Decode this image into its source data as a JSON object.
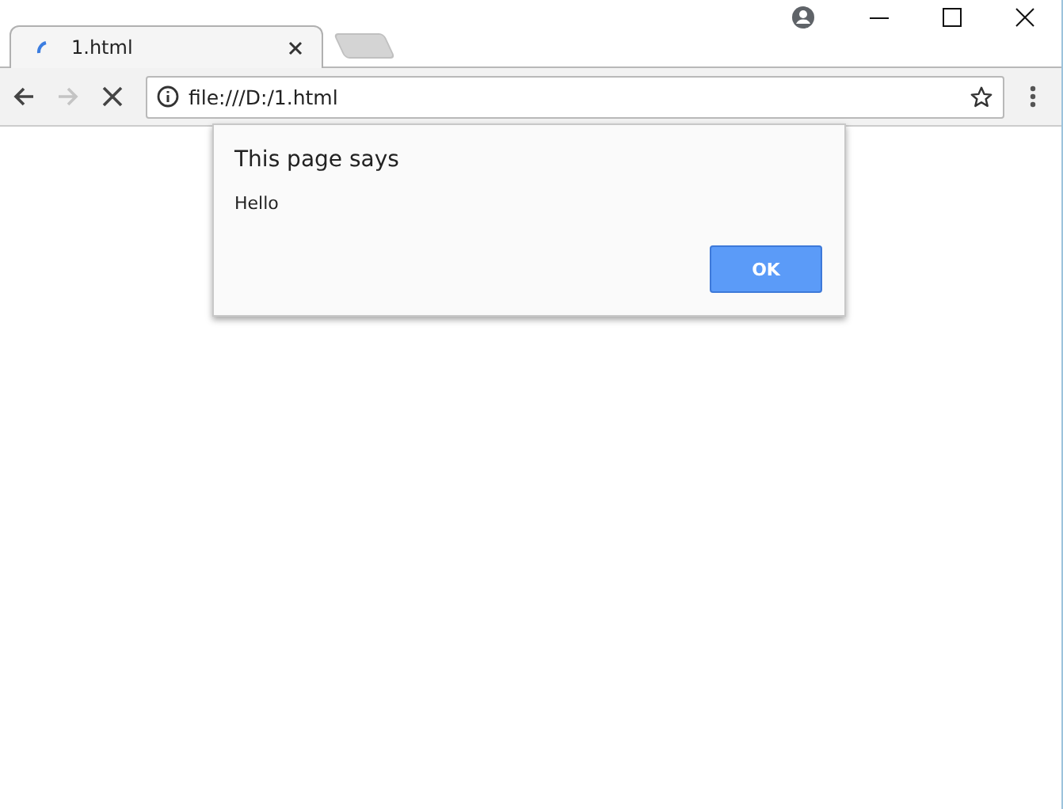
{
  "tabs": [
    {
      "title": "1.html",
      "loading": true,
      "selected": true
    }
  ],
  "toolbar": {
    "nav": [
      {
        "kind": "back",
        "disabled": false
      },
      {
        "kind": "forward",
        "disabled": true
      },
      {
        "kind": "stop",
        "disabled": false
      }
    ],
    "address": {
      "url": "file:///D:/1.html"
    }
  },
  "dialog": {
    "title": "This page says",
    "message": "Hello",
    "buttons": [
      {
        "label": "OK",
        "selected": true
      }
    ]
  }
}
